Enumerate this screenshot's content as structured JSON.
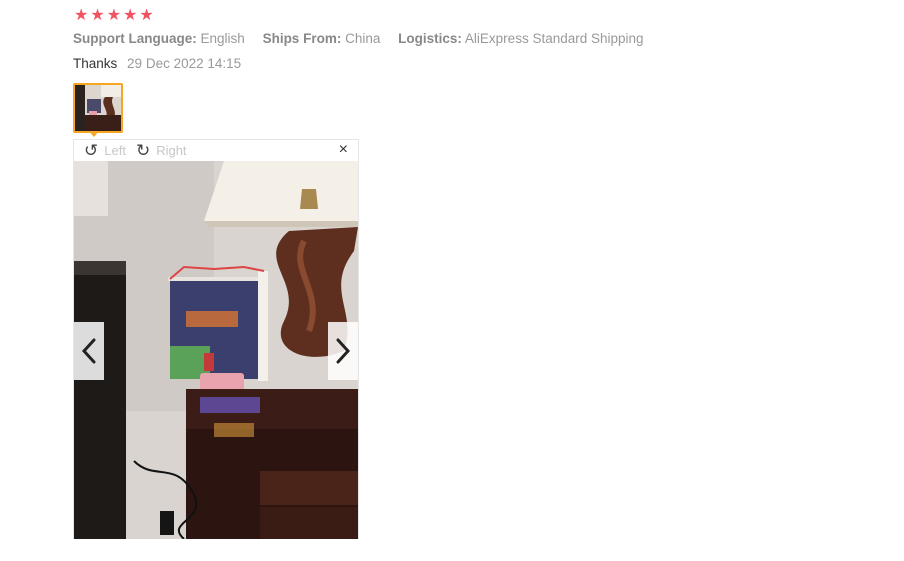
{
  "review": {
    "rating": 5,
    "stars": [
      "★",
      "★",
      "★",
      "★",
      "★"
    ],
    "support_language_label": "Support Language:",
    "support_language_value": "English",
    "ships_from_label": "Ships From:",
    "ships_from_value": "China",
    "logistics_label": "Logistics:",
    "logistics_value": "AliExpress Standard Shipping",
    "comment": "Thanks",
    "date": "29 Dec 2022 14:15"
  },
  "viewer": {
    "rotate_left_label": "Left",
    "rotate_right_label": "Right",
    "close_icon": "×"
  },
  "colors": {
    "star": "#f05463",
    "thumb_border": "#f5a623"
  }
}
